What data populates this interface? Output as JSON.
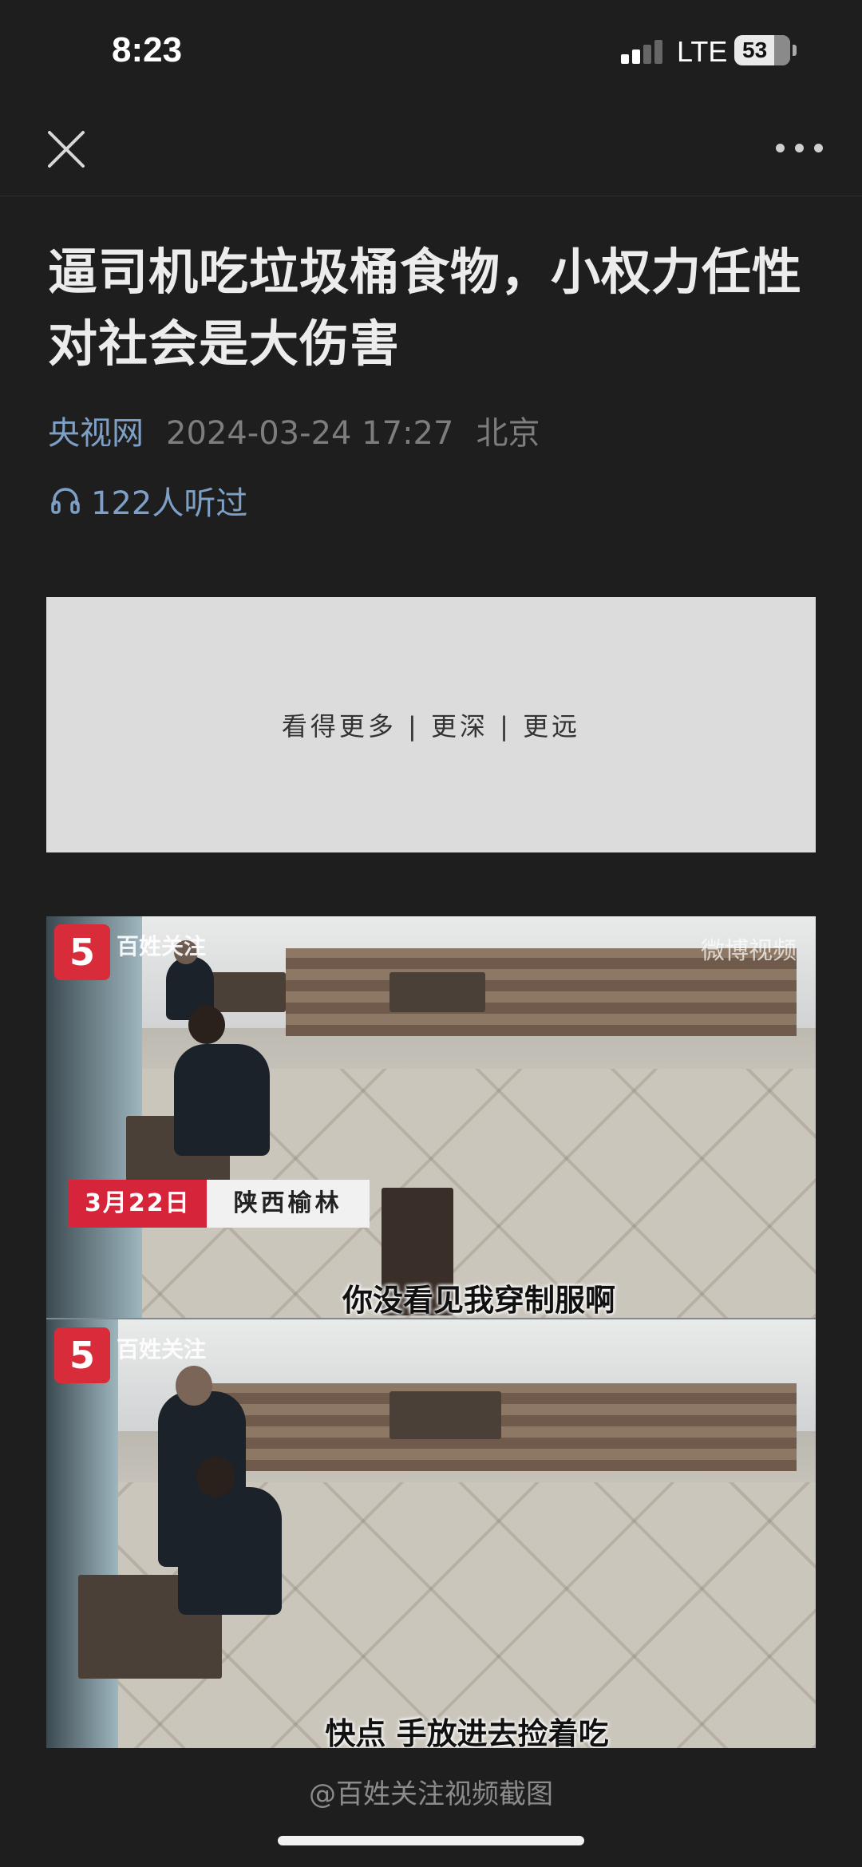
{
  "status_bar": {
    "time": "8:23",
    "network": "LTE",
    "battery": "53"
  },
  "nav": {
    "close_icon": "close-icon",
    "more_icon": "more-dots-icon"
  },
  "article": {
    "title": "逼司机吃垃圾桶食物，小权力任性对社会是大伤害",
    "source": "央视网",
    "date": "2024-03-24 17:27",
    "location": "北京",
    "listen_count": "122人听过"
  },
  "ad": {
    "text": "看得更多 | 更深 | 更远"
  },
  "image": {
    "logo_text": "百姓关注",
    "watermark": "微博视频",
    "date_tag": "3月22日",
    "place_tag": "陕西榆林",
    "subtitle_1": "你没看见我穿制服啊",
    "subtitle_2": "快点 手放进去捡着吃",
    "caption": "@百姓关注视频截图"
  },
  "colors": {
    "background": "#1e1e1f",
    "link_blue": "#7fa0c6",
    "tag_red": "#d6243a"
  }
}
